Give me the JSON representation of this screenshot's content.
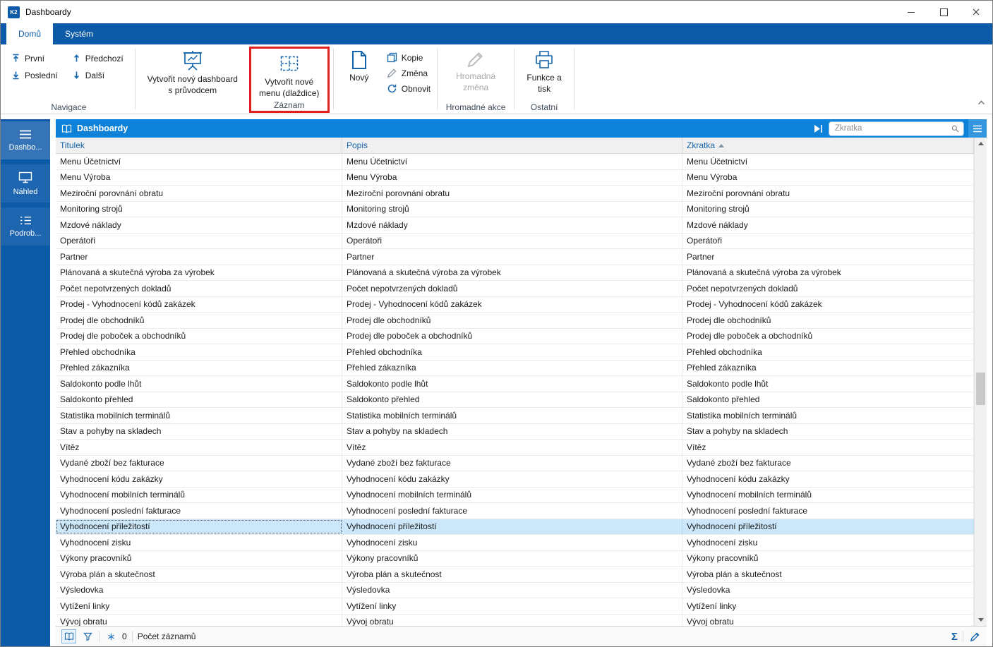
{
  "window": {
    "title": "Dashboardy",
    "app_badge": "K2"
  },
  "tabs": [
    {
      "label": "Domů",
      "active": true
    },
    {
      "label": "Systém",
      "active": false
    }
  ],
  "ribbon": {
    "nav": {
      "first": "První",
      "last": "Poslední",
      "prev": "Předchozí",
      "next": "Další",
      "group_label": "Navigace"
    },
    "record": {
      "create_dashboard_line1": "Vytvořit nový dashboard",
      "create_dashboard_line2": "s průvodcem",
      "create_menu_line1": "Vytvořit nové",
      "create_menu_line2": "menu (dlaždice)",
      "group_label": "Záznam",
      "new": "Nový",
      "copy": "Kopie",
      "change": "Změna",
      "refresh": "Obnovit"
    },
    "bulk": {
      "bulk_change_line1": "Hromadná",
      "bulk_change_line2": "změna",
      "group_label": "Hromadné akce"
    },
    "other": {
      "functions_line1": "Funkce a",
      "functions_line2": "tisk",
      "group_label": "Ostatní"
    }
  },
  "sidebar": {
    "items": [
      {
        "label": "Dashbo...",
        "icon": "menu-icon",
        "active": true
      },
      {
        "label": "Náhled",
        "icon": "monitor-icon",
        "active": false
      },
      {
        "label": "Podrob...",
        "icon": "list-icon",
        "active": false
      }
    ]
  },
  "content": {
    "title": "Dashboardy",
    "search_placeholder": "Zkratka",
    "columns": [
      {
        "label": "Titulek",
        "sorted": false
      },
      {
        "label": "Popis",
        "sorted": false
      },
      {
        "label": "Zkratka",
        "sorted": true,
        "sort_dir": "asc"
      }
    ],
    "rows": [
      "Menu Účetnictví",
      "Menu Výroba",
      "Meziroční porovnání obratu",
      "Monitoring strojů",
      "Mzdové náklady",
      "Operátoři",
      "Partner",
      "Plánovaná a skutečná výroba za výrobek",
      "Počet nepotvrzených dokladů",
      "Prodej - Vyhodnocení kódů zakázek",
      "Prodej dle obchodníků",
      "Prodej dle poboček a obchodníků",
      "Přehled obchodníka",
      "Přehled zákazníka",
      "Saldokonto podle lhůt",
      "Saldokonto přehled",
      "Statistika mobilních terminálů",
      "Stav a pohyby na skladech",
      "Vítěz",
      "Vydané zboží bez fakturace",
      "Vyhodnocení kódu zakázky",
      "Vyhodnocení mobilních terminálů",
      "Vyhodnocení poslední fakturace",
      "Vyhodnocení příležitostí",
      "Vyhodnocení zisku",
      "Výkony pracovníků",
      "Výroba plán a skutečnost",
      "Výsledovka",
      "Vytížení linky",
      "Vývoj obratu"
    ],
    "selected_index": 23
  },
  "statusbar": {
    "counter_value": "0",
    "records_label": "Počet záznamů"
  },
  "icons": {
    "sum": "Σ"
  },
  "colors": {
    "brand_blue": "#0d5aa9",
    "header_blue": "#0e82d8",
    "link_blue": "#1464ac",
    "selection_blue": "#cbe7f9",
    "highlight_red": "#e01f1f"
  }
}
